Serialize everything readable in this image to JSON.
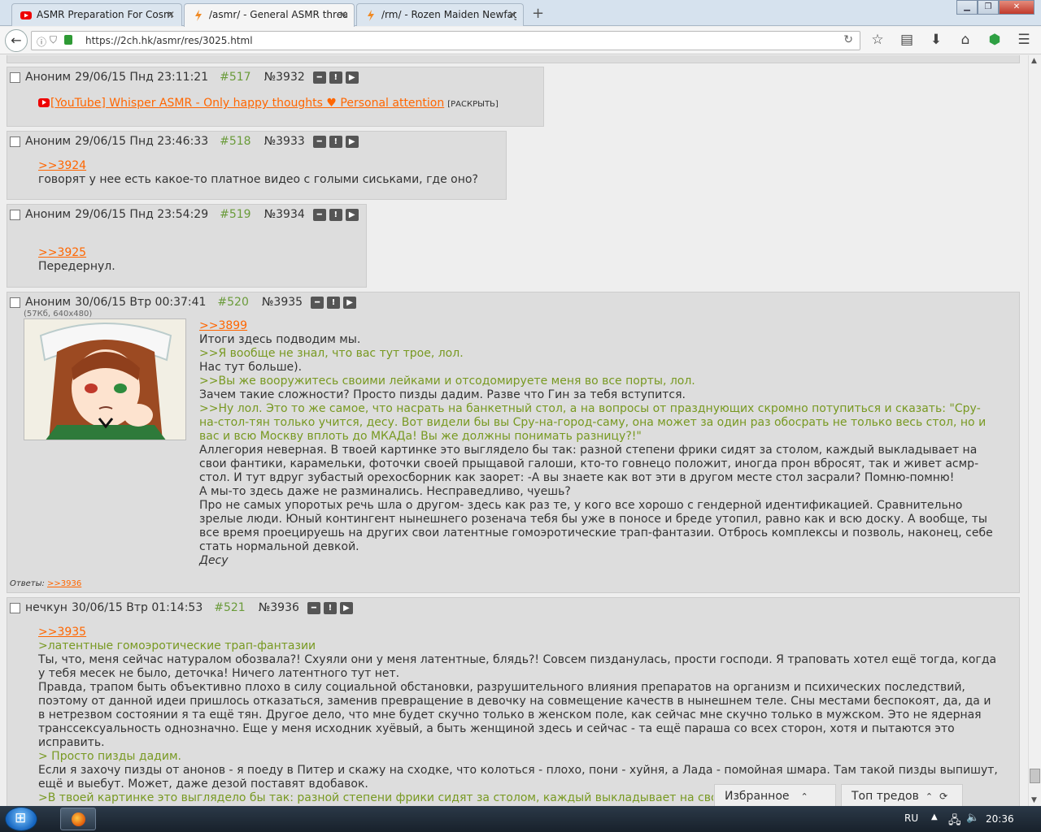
{
  "browser": {
    "tabs": [
      {
        "title": "ASMR Preparation For Cosm",
        "favicon": "youtube-icon"
      },
      {
        "title": "/asmr/ - General ASMR threa",
        "favicon": "lightning-icon"
      },
      {
        "title": "/rm/ - Rozen Maiden Newfag",
        "favicon": "lightning-icon"
      }
    ],
    "new_tab": "+",
    "url": "https://2ch.hk/asmr/res/3025.html"
  },
  "posts": [
    {
      "name": "Аноним",
      "date": "29/06/15 Пнд 23:11:21",
      "num": "#517",
      "id": "№3932",
      "youtube": "[YouTube] Whisper ASMR - Only happy thoughts ♥ Personal attention",
      "expand": "[РАСКРЫТЬ]"
    },
    {
      "name": "Аноним",
      "date": "29/06/15 Пнд 23:46:33",
      "num": "#518",
      "id": "№3933",
      "lines": [
        {
          "t": "link",
          "text": ">>3924"
        },
        {
          "t": "text",
          "text": "говорят у нее есть какое-то платное видео с голыми сиськами, где оно?"
        }
      ]
    },
    {
      "name": "Аноним",
      "date": "29/06/15 Пнд 23:54:29",
      "num": "#519",
      "id": "№3934",
      "lines": [
        {
          "t": "link",
          "text": ">>3925"
        },
        {
          "t": "text",
          "text": "Передернул."
        }
      ]
    },
    {
      "name": "Аноним",
      "date": "30/06/15 Втр 00:37:41",
      "num": "#520",
      "id": "№3935",
      "filesize": "(57Кб, 640x480)",
      "lines": [
        {
          "t": "link",
          "text": ">>3899"
        },
        {
          "t": "text",
          "text": "Итоги здесь подводим мы."
        },
        {
          "t": "green",
          "text": ">>Я вообще не знал, что вас тут трое, лол."
        },
        {
          "t": "text",
          "text": "Нас тут больше)."
        },
        {
          "t": "green",
          "text": ">>Вы же вооружитесь своими лейками и отсодомируете меня во все порты, лол."
        },
        {
          "t": "text",
          "text": "Зачем такие сложности? Просто пизды дадим. Разве что Гин за тебя вступится."
        },
        {
          "t": "green",
          "text": ">>Ну лол. Это то же самое, что насрать на банкетный стол, а на вопросы от празднующих скромно потупиться и сказать: \"Сру-на-стол-тян только учится, десу. Вот видели бы вы Сру-на-город-саму, она может за один раз обосрать не только весь стол, но и вас и всю Москву вплоть до МКАДа! Вы же должны понимать разницу?!\""
        },
        {
          "t": "text",
          "text": "Аллегория неверная. В твоей картинке это выглядело бы так: разной степени фрики сидят за столом, каждый выкладывает на свои фантики, карамельки, фоточки своей прыщавой галоши, кто-то говнецо положит, иногда прон вбросят, так и живет асмр-стол. И тут вдруг зубастый орехосборник как заорет: -А вы знаете как вот эти в другом месте стол засрали? Помню-помню!"
        },
        {
          "t": "text",
          "text": "А мы-то здесь даже не разминались. Несправедливо, чуешь?"
        },
        {
          "t": "text",
          "text": "Про не самых упоротых речь шла о другом- здесь как раз те, у кого все хорошо с гендерной идентификацией. Сравнительно зрелые люди. Юный контингент нынешнего розенача тебя бы уже в поносе и бреде утопил, равно как и всю доску. А вообще, ты все время проецируешь на других свои латентные гомоэротические трап-фантазии. Отбрось комплексы и позволь, наконец, себе стать нормальной девкой."
        },
        {
          "t": "italic",
          "text": "Десу"
        }
      ],
      "replies_label": "Ответы:",
      "replies": ">>3936"
    },
    {
      "name": "нечкун",
      "date": "30/06/15 Втр 01:14:53",
      "num": "#521",
      "id": "№3936",
      "lines": [
        {
          "t": "link",
          "text": ">>3935"
        },
        {
          "t": "green",
          "text": ">латентные гомоэротические трап-фантазии"
        },
        {
          "t": "text",
          "text": "Ты, что, меня сейчас натуралом обозвала?! Схуяли они у меня латентные, блядь?! Совсем пизданулась, прости господи. Я траповать хотел ещё тогда, когда у тебя месек не было, деточка! Ничего латентного тут нет."
        },
        {
          "t": "text",
          "text": "Правда, трапом быть объективно плохо в силу социальной обстановки, разрушительного влияния препаратов на организм и психических последствий, поэтому от данной идеи пришлось отказаться, заменив превращение в девочку на совмещение качеств в нынешнем теле. Сны местами беспокоят, да, да и в нетрезвом состоянии я та ещё тян. Другое дело, что мне будет скучно только в женском поле, как сейчас мне скучно только в мужском. Это не ядерная транссексуальность однозначно. Еще у меня исходник хуёвый, а быть женщиной здесь и сейчас - та ещё параша со всех сторон, хотя и пытаются это исправить."
        },
        {
          "t": "green",
          "text": "> Просто пизды дадим."
        },
        {
          "t": "text",
          "text": "Если я захочу пизды от анонов - я поеду в Питер и скажу на сходке, что колоться - плохо, пони - хуйня, а Лада - помойная шмара. Там такой пизды выпишут, ещё и выебут. Может, даже дезой поставят вдобавок."
        },
        {
          "t": "green",
          "text": ">В твоей картинке это выглядело бы так: разной степени фрики сидят за столом, каждый выкладывает на свои"
        }
      ]
    }
  ],
  "float_buttons": {
    "favorites": "Избранное",
    "top_threads": "Топ тредов"
  },
  "taskbar": {
    "lang": "RU",
    "time": "20:36"
  }
}
